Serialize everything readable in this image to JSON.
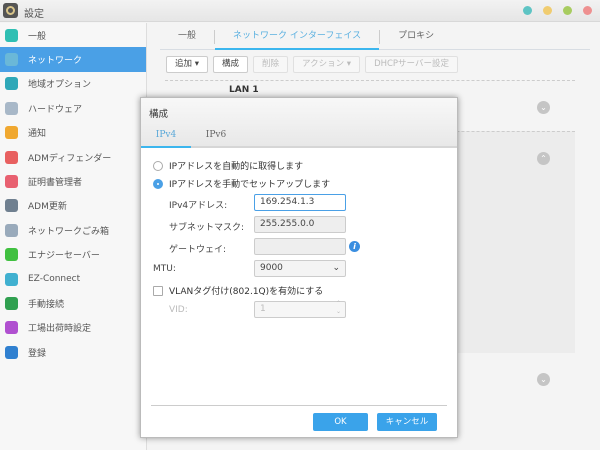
{
  "window": {
    "title": "設定"
  },
  "sidebar": {
    "items": [
      {
        "label": "一般",
        "color": "#2fbfb3"
      },
      {
        "label": "ネットワーク",
        "color": "#6ab8d8"
      },
      {
        "label": "地域オプション",
        "color": "#2fa8b8"
      },
      {
        "label": "ハードウェア",
        "color": "#a8b8c8"
      },
      {
        "label": "通知",
        "color": "#f0a830"
      },
      {
        "label": "ADMディフェンダー",
        "color": "#e86060"
      },
      {
        "label": "証明書管理者",
        "color": "#e86070"
      },
      {
        "label": "ADM更新",
        "color": "#708090"
      },
      {
        "label": "ネットワークごみ箱",
        "color": "#9ab"
      },
      {
        "label": "エナジーセーバー",
        "color": "#40c040"
      },
      {
        "label": "EZ-Connect",
        "color": "#40b0d0"
      },
      {
        "label": "手動接続",
        "color": "#30a050"
      },
      {
        "label": "工場出荷時設定",
        "color": "#b050d0"
      },
      {
        "label": "登録",
        "color": "#3080d0"
      }
    ]
  },
  "tabs": [
    "一般",
    "ネットワーク インターフェイス",
    "プロキシ"
  ],
  "toolbar": {
    "add": "追加",
    "configure": "構成",
    "delete": "削除",
    "action": "アクション",
    "dhcp": "DHCPサーバー設定"
  },
  "list": {
    "lan1": "LAN 1"
  },
  "dialog": {
    "title": "構成",
    "tabs": [
      "IPv4",
      "IPv6"
    ],
    "radio_auto": "IPアドレスを自動的に取得します",
    "radio_manual": "IPアドレスを手動でセットアップします",
    "ipv4_label": "IPv4アドレス:",
    "ipv4_value": "169.254.1.3",
    "subnet_label": "サブネットマスク:",
    "subnet_value": "255.255.0.0",
    "gateway_label": "ゲートウェイ:",
    "gateway_value": "",
    "mtu_label": "MTU:",
    "mtu_value": "9000",
    "vlan_label": "VLANタグ付け(802.1Q)を有効にする",
    "vid_label": "VID:",
    "vid_value": "1",
    "ok": "OK",
    "cancel": "キャンセル"
  }
}
